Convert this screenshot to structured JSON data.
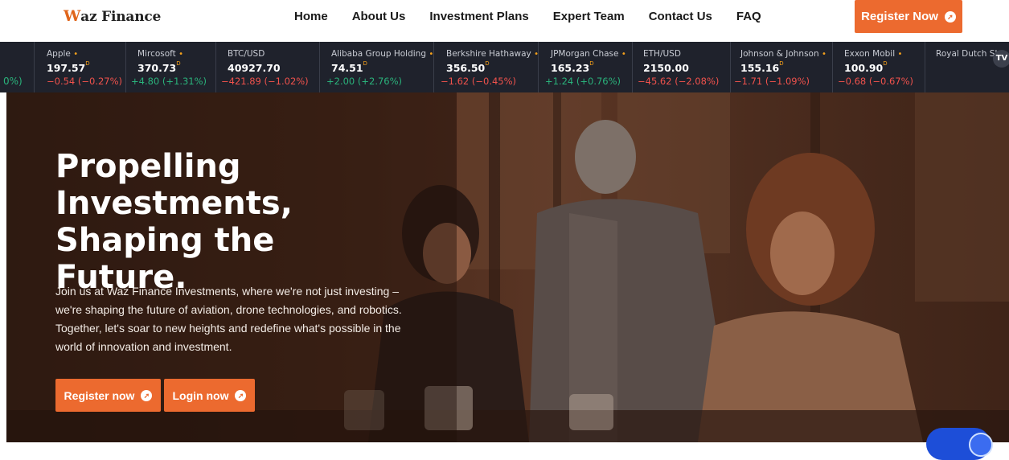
{
  "header": {
    "logo_first": "W",
    "logo_rest": "az Finance",
    "nav": [
      "Home",
      "About Us",
      "Investment Plans",
      "Expert Team",
      "Contact Us",
      "FAQ"
    ],
    "register_label": "Register Now",
    "arrow_icon": "arrow-up-right-circle-icon"
  },
  "ticker": {
    "clipped_text": "0%)",
    "items": [
      {
        "name": "Apple",
        "dot": "•",
        "price": "197.57",
        "suffix": "D",
        "change": "−0.54 (−0.27%)",
        "direction": "down"
      },
      {
        "name": "Mircosoft",
        "dot": "•",
        "price": "370.73",
        "suffix": "D",
        "change": "+4.80 (+1.31%)",
        "direction": "up"
      },
      {
        "name": "BTC/USD",
        "dot": "",
        "price": "40927.70",
        "suffix": "",
        "change": "−421.89 (−1.02%)",
        "direction": "down"
      },
      {
        "name": "Alibaba Group Holding",
        "dot": "•",
        "price": "74.51",
        "suffix": "D",
        "change": "+2.00 (+2.76%)",
        "direction": "up"
      },
      {
        "name": "Berkshire Hathaway",
        "dot": "•",
        "price": "356.50",
        "suffix": "D",
        "change": "−1.62 (−0.45%)",
        "direction": "down"
      },
      {
        "name": "JPMorgan Chase",
        "dot": "•",
        "price": "165.23",
        "suffix": "D",
        "change": "+1.24 (+0.76%)",
        "direction": "up"
      },
      {
        "name": "ETH/USD",
        "dot": "",
        "price": "2150.00",
        "suffix": "",
        "change": "−45.62 (−2.08%)",
        "direction": "down"
      },
      {
        "name": "Johnson & Johnson",
        "dot": "•",
        "price": "155.16",
        "suffix": "D",
        "change": "−1.71 (−1.09%)",
        "direction": "down"
      },
      {
        "name": "Exxon Mobil",
        "dot": "•",
        "price": "100.90",
        "suffix": "D",
        "change": "−0.68 (−0.67%)",
        "direction": "down"
      },
      {
        "name": "Royal Dutch Sh",
        "dot": "",
        "price": "",
        "suffix": "",
        "change": "",
        "direction": "down"
      }
    ],
    "tv_badge": "TV"
  },
  "hero": {
    "title": "Propelling\nInvestments,\nShaping the Future.",
    "description": "Join us at Waz Finance Investments, where we're not just investing – we're shaping the future of aviation, drone technologies, and robotics. Together, let's soar to new heights and redefine what's possible in the world of innovation and investment.",
    "register_label": "Register now",
    "login_label": "Login now"
  },
  "colors": {
    "accent": "#ec6a2f",
    "ticker_bg": "#1f222c",
    "up": "#2ab27b",
    "down": "#f0524c",
    "dot": "#f7a21b"
  }
}
